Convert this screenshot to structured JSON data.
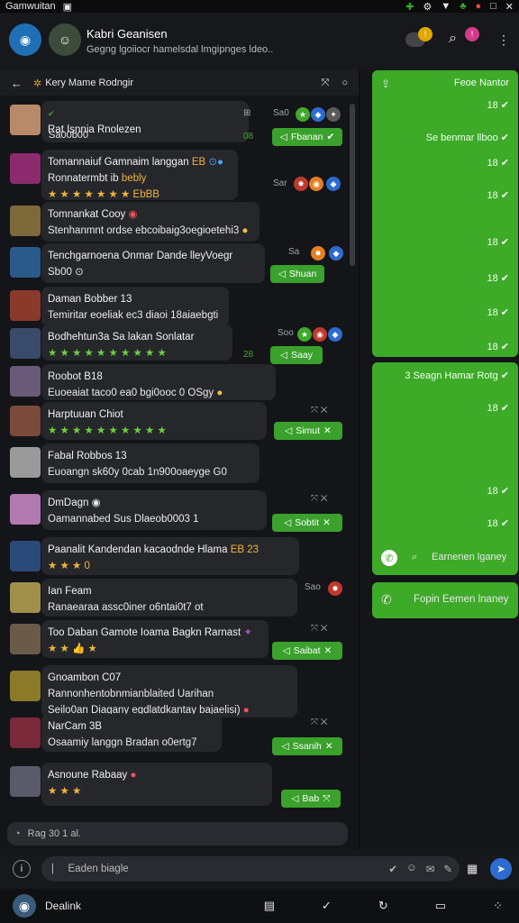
{
  "status": {
    "app": "Gamwuitan",
    "icons": [
      "☠",
      "⚙",
      "▼",
      "♣",
      "●",
      "□"
    ]
  },
  "header": {
    "title": "Kabri Geanisen",
    "subtitle": "Gegng lgoiiocr hamelsdal lmgipnges ldeo..",
    "badge1": "!",
    "badge2": "!"
  },
  "subbar": {
    "title": "Kery Mame Rodngir"
  },
  "messages": [
    {
      "name": "Rat Isnnia Rnolezen",
      "line2": "Sa00b00",
      "time": "Sa0",
      "pill": "Fbanan",
      "pill_time": "08"
    },
    {
      "name": "Tomannaiuf Gamnaim langgan",
      "line2": "Ronnatermbt ib",
      "line2b": "bebly",
      "emoji": "★ ★ ★ ★ ★ ★ ★ EbBB",
      "time": "Sar"
    },
    {
      "name": "Tomnankat  Cooy",
      "line2": "Stenhanmnt ordse ebcoibaig3oegioetehi3"
    },
    {
      "name": "Tenchgarnoena Onmar Dande lleyVoegr",
      "line2": "Sb00",
      "time": "Sa",
      "pill": "Shuan"
    },
    {
      "name": "Daman  Bobber  13",
      "line2": "Temiritar eoeliak ec3 diaoi 18aiaebgti"
    },
    {
      "name": "Bodhehtun3a Sa lakan Sonlatar",
      "line2": "★ ★ ★ ★ ★ ★ ★ ★ ★ ★",
      "time": "Soo",
      "pill": "Saay",
      "pill_time": "28"
    },
    {
      "name": "Roobot  B18",
      "line2": "Euoeaiat taco0 ea0 bgi0ooc 0 OSgy"
    },
    {
      "name": "Harptuuan  Chiot",
      "line2": "★ ★ ★ ★ ★ ★ ★ ★ ★ ★",
      "pill": "Simut"
    },
    {
      "name": "Fabal  Robbos  13",
      "line2": "Euoangn sk60y 0cab 1n900oaeyge G0"
    },
    {
      "name": "DmDagn",
      "line2": "Oamannabed Sus Dlaeob0003 1",
      "pill": "Sobtit"
    },
    {
      "name": "Paanalit Kandendan kacaodnde Hlama",
      "line2": "★ ★ ★ 0",
      "tag": "EB 23"
    },
    {
      "name": "Ian Feam",
      "line2": "Ranaearaa assc0iner o6ntai0t7 ot",
      "time": "Sao"
    },
    {
      "name": "Too Daban Gamote Ioama Bagkn Rarnast",
      "line2": "★ ★ 👍 ★",
      "pill": "Saibat"
    },
    {
      "name": "Gnoambon  C07",
      "line2": "Rannonhentobnmianblaited Uarihan",
      "line3": "Seilo0an Diagany egdlatdkantay bajaelisi)"
    },
    {
      "name": "NarCam  3B",
      "line2": "Osaamiy langgn Bradan o0ertg7",
      "pill": "Ssanih"
    },
    {
      "name": "Asnoune Rabaay",
      "line2": "★ ★ ★",
      "pill": "Bab"
    }
  ],
  "panel": {
    "title": "Feoe Nantor",
    "rows": [
      "18",
      "Se benmar llboo",
      "18",
      "18",
      "18",
      "18",
      "18",
      "18"
    ],
    "section2": "3 Seagn Hamar Rotg",
    "rows2": [
      "18",
      "18",
      "18"
    ],
    "btn1": "Earnenen lganey",
    "btn2": "Fopin Eemen lnaney"
  },
  "composer": {
    "placeholder": "Rag 30  1 al."
  },
  "input": {
    "placeholder": "Eaden biagle"
  },
  "bottom": {
    "label": "Dealink"
  },
  "colors": {
    "accent": "#3daa28",
    "bg": "#141518",
    "bubble": "#26272b"
  }
}
